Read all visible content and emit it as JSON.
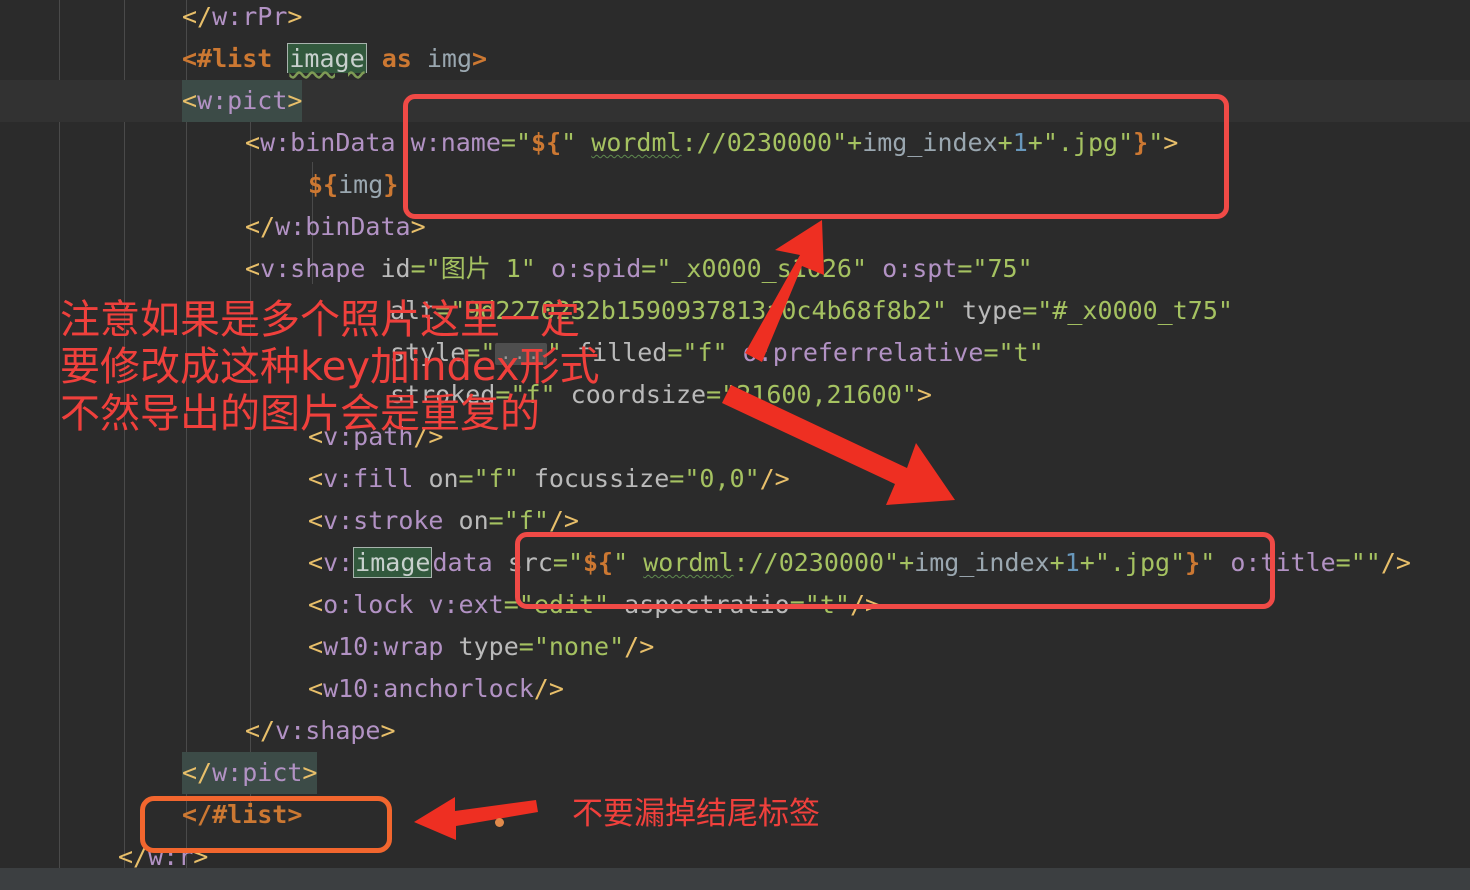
{
  "window": {
    "kind": "code-editor",
    "theme": "darcula",
    "background": "#2b2b2b",
    "statusbar_background": "#3c3f41"
  },
  "colors": {
    "annotation_red": "#f0403c",
    "box_red": "#f04a46",
    "box_orange": "#f2662e",
    "arrow_red": "#ee2f22",
    "occurrence_highlight": "#32593d",
    "block_highlight": "#3c4b47",
    "string": "#a5c261",
    "tag": "#b292c4",
    "punct": "#e8bf6a",
    "directive": "#cc7832",
    "number": "#6897bb",
    "attribute": "#bababa"
  },
  "code": {
    "lines": [
      {
        "indent": 5,
        "text": "</w:rPr>"
      },
      {
        "indent": 5,
        "text": "<#list image as img>"
      },
      {
        "indent": 5,
        "text": "<w:pict>"
      },
      {
        "indent": 7,
        "text": "<w:binData w:name=\"${\" wordml://0230000\"+img_index+1+\".jpg\"}\">"
      },
      {
        "indent": 9,
        "text": "${img}"
      },
      {
        "indent": 7,
        "text": "</w:binData>"
      },
      {
        "indent": 7,
        "text": "<v:shape id=\"图片 1\" o:spid=\"_x0000_s1026\" o:spt=\"75\""
      },
      {
        "indent": 11,
        "text": "alt=\"9d2270232b1590937813a0c4b68f8b2\" type=\"#_x0000_t75\""
      },
      {
        "indent": 11,
        "text": "style=\"...\" filled=\"f\" o:preferrelative=\"t\""
      },
      {
        "indent": 11,
        "text": "stroked=\"f\" coordsize=\"21600,21600\">"
      },
      {
        "indent": 9,
        "text": "<v:path/>"
      },
      {
        "indent": 9,
        "text": "<v:fill on=\"f\" focussize=\"0,0\"/>"
      },
      {
        "indent": 9,
        "text": "<v:stroke on=\"f\"/>"
      },
      {
        "indent": 9,
        "text": "<v:imagedata src=\"${\" wordml://0230000\"+img_index+1+\".jpg\"}\" o:title=\"\"/>"
      },
      {
        "indent": 9,
        "text": "<o:lock v:ext=\"edit\" aspectratio=\"t\"/>"
      },
      {
        "indent": 9,
        "text": "<w10:wrap type=\"none\"/>"
      },
      {
        "indent": 9,
        "text": "<w10:anchorlock/>"
      },
      {
        "indent": 7,
        "text": "</v:shape>"
      },
      {
        "indent": 5,
        "text": "</w:pict>"
      },
      {
        "indent": 5,
        "text": "</#list>"
      },
      {
        "indent": 3,
        "text": "</w:r>"
      }
    ],
    "search_term": "image",
    "folded_placeholder": "..."
  },
  "annotations": {
    "note_main": "注意如果是多个照片这里一定\n要修改成这种key加index形式\n不然导出的图片会是重复的",
    "note_main_lines": [
      "注意如果是多个照片这里一定",
      "要修改成这种key加index形式",
      "不然导出的图片会是重复的"
    ],
    "note_bottom": "不要漏掉结尾标签",
    "boxes": [
      {
        "name": "binData-name-attribute-box",
        "color": "#f04a46"
      },
      {
        "name": "imagedata-src-attribute-box",
        "color": "#f04a46"
      },
      {
        "name": "list-close-tag-box",
        "color": "#f2662e"
      }
    ],
    "arrows": [
      {
        "name": "arrow-up-to-name-box",
        "direction": "up-right"
      },
      {
        "name": "arrow-down-to-src-box",
        "direction": "down-right"
      },
      {
        "name": "arrow-left-to-list-box",
        "direction": "left"
      }
    ]
  }
}
